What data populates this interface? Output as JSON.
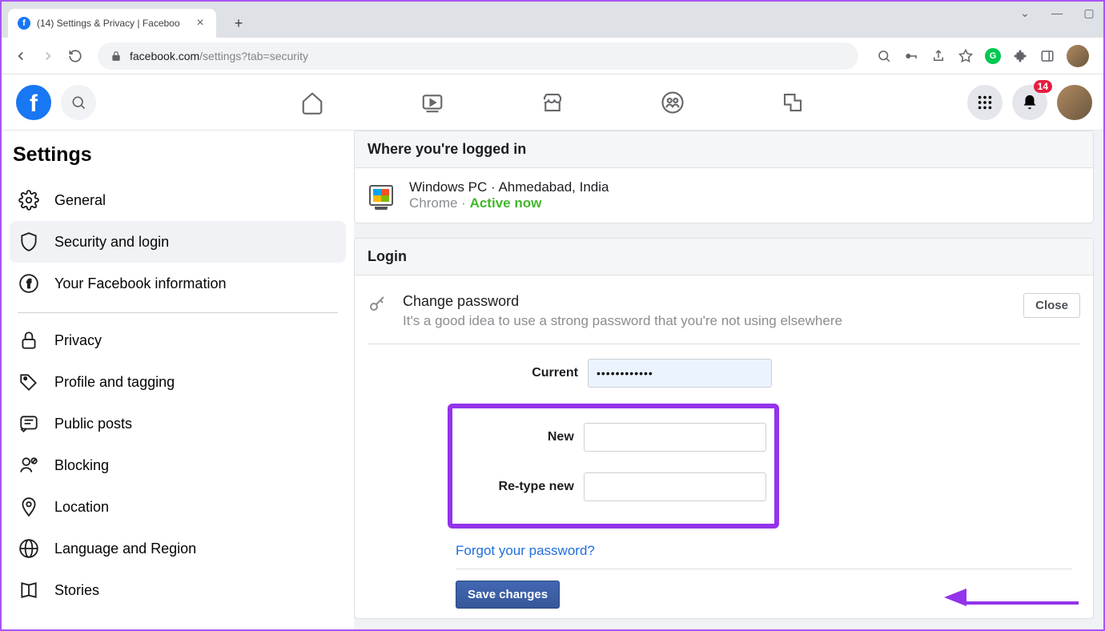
{
  "browser": {
    "tab_title": "(14) Settings & Privacy | Faceboo",
    "url_domain": "facebook.com",
    "url_path": "/settings?tab=security"
  },
  "fb_header": {
    "notification_count": "14"
  },
  "sidebar": {
    "heading": "Settings",
    "items": [
      {
        "icon": "gear",
        "label": "General"
      },
      {
        "icon": "shield",
        "label": "Security and login"
      },
      {
        "icon": "fbcircle",
        "label": "Your Facebook information"
      },
      {
        "icon": "lock",
        "label": "Privacy"
      },
      {
        "icon": "tag",
        "label": "Profile and tagging"
      },
      {
        "icon": "posts",
        "label": "Public posts"
      },
      {
        "icon": "block",
        "label": "Blocking"
      },
      {
        "icon": "location",
        "label": "Location"
      },
      {
        "icon": "globe",
        "label": "Language and Region"
      },
      {
        "icon": "book",
        "label": "Stories"
      }
    ],
    "active_index": 1,
    "divider_after_index": 2
  },
  "card1": {
    "header": "Where you're logged in",
    "session_title": "Windows PC · Ahmedabad, India",
    "session_browser": "Chrome · ",
    "session_status": "Active now"
  },
  "card2": {
    "header": "Login",
    "change_title": "Change password",
    "change_desc": "It's a good idea to use a strong password that you're not using elsewhere",
    "close_label": "Close",
    "labels": {
      "current": "Current",
      "new": "New",
      "retype": "Re-type new"
    },
    "current_value": "••••••••••••",
    "forgot_label": "Forgot your password?",
    "save_label": "Save changes"
  }
}
